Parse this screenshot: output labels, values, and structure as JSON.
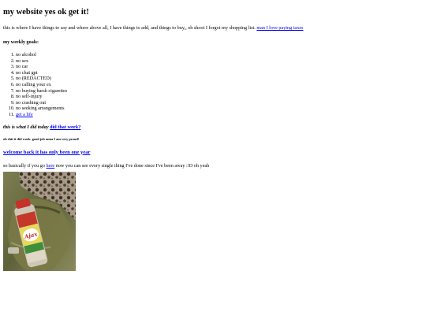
{
  "site": {
    "title": "my website yes ok get it!"
  },
  "intro": {
    "text": "this is where I have things to say and where above all, I have things to add, and things to buy,, oh shoot I forgot my shopping list. ",
    "link": "man I love paying taxes"
  },
  "goals": {
    "heading": "my weekly goals:",
    "items": [
      "no alcohol",
      "no sex",
      "no car",
      "no chat gpt",
      "no (REDACTED)",
      "no calling your ex",
      "no buying harsh cigarettes",
      "no self-injury",
      "no crashing out",
      "no seeking arrangements"
    ],
    "link_item": "get a life"
  },
  "today": {
    "label": "this is what I did today",
    "link": "did that work?"
  },
  "note": "oh shit it did work. good job anna I am very proud!",
  "welcome": {
    "link": "welcome back it has only been one year"
  },
  "basically": {
    "before": "so basically if you go ",
    "link": "here",
    "after": " now you can see every single thing I've done since I've been away :!D oh yeah"
  },
  "photo": {
    "label_text": "Ajax"
  },
  "colors": {
    "link": "#0000ee",
    "text": "#000000",
    "background": "#ffffff"
  }
}
